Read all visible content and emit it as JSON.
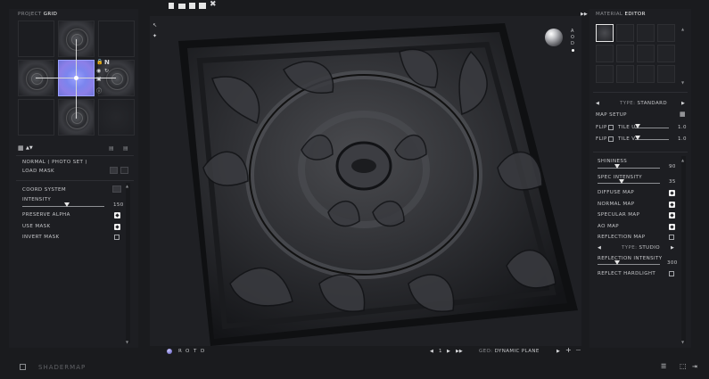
{
  "toolbar": {
    "icons": [
      "new-document-icon",
      "open-folder-icon",
      "save-icon",
      "save-as-icon",
      "settings-icon"
    ]
  },
  "project_grid": {
    "label_prefix": "PROJECT",
    "label_value": "GRID"
  },
  "node": {
    "title": "NORMAL ( PHOTO SET )",
    "load_mask": "LOAD MASK",
    "coord_system": "COORD SYSTEM",
    "intensity_label": "INTENSITY",
    "intensity_value": "150",
    "intensity_fraction": 0.48,
    "preserve_alpha": "PRESERVE ALPHA",
    "use_mask": "USE MASK",
    "invert_mask": "INVERT MASK"
  },
  "viewport": {
    "render_modes": [
      "R",
      "O",
      "T",
      "D"
    ],
    "page_value": "1",
    "geo_label": "GEO:",
    "geo_value": "DYNAMIC PLANE",
    "sphere_controls": [
      "A",
      "O",
      "D"
    ]
  },
  "material_editor": {
    "label_prefix": "MATERIAL",
    "label_value": "EDITOR",
    "type_label": "TYPE:",
    "type_value": "STANDARD",
    "map_setup": "MAP SETUP",
    "flip_label": "FLIP",
    "tile_u_label": "TILE U",
    "tile_u_value": "1.0",
    "tile_v_label": "TILE V",
    "tile_v_value": "1.0",
    "shininess_label": "SHININESS",
    "shininess_value": "90",
    "spec_intensity_label": "SPEC INTENSITY",
    "spec_intensity_value": "35",
    "diffuse_map": "DIFFUSE MAP",
    "normal_map": "NORMAL MAP",
    "specular_map": "SPECULAR MAP",
    "ao_map": "AO MAP",
    "reflection_map": "REFLECTION MAP",
    "reflection_type_label": "TYPE:",
    "reflection_type_value": "STUDIO",
    "reflection_intensity_label": "REFLECTION INTENSITY",
    "reflection_intensity_value": "300",
    "reflect_hardlight": "REFLECT HARDLIGHT"
  },
  "footer": {
    "logo": "SHADERMAP"
  }
}
